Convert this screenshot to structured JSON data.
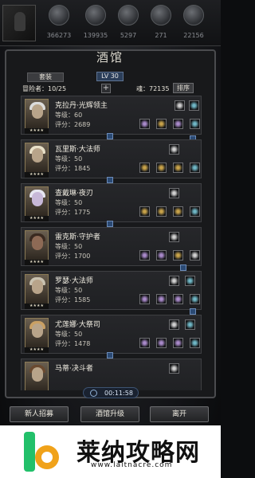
{
  "resources": [
    {
      "icon": "gold-orb-icon",
      "value": "366273"
    },
    {
      "icon": "silver-orb-icon",
      "value": "139935"
    },
    {
      "icon": "gem-orb-icon",
      "value": "5297"
    },
    {
      "icon": "soul-orb-icon",
      "value": "271"
    },
    {
      "icon": "dark-orb-icon",
      "value": "22156"
    }
  ],
  "panel": {
    "title": "酒馆",
    "tab_label": "套装",
    "level": "LV 30",
    "adventurers": "冒险者：10/25",
    "souls": "魂：72135",
    "sort_label": "排序"
  },
  "heroes": [
    {
      "name": "克拉丹·光辉领主",
      "level": "等级：60",
      "score": "评分：2689",
      "stars": "★★★★"
    },
    {
      "name": "瓦里斯·大法师",
      "level": "等级：50",
      "score": "评分：1845",
      "stars": "★★★★"
    },
    {
      "name": "查戴琳·夜刃",
      "level": "等级：50",
      "score": "评分：1775",
      "stars": "★★★★"
    },
    {
      "name": "雷克斯·守护者",
      "level": "等级：50",
      "score": "评分：1700",
      "stars": "★★★★"
    },
    {
      "name": "罗瑟·大法师",
      "level": "等级：50",
      "score": "评分：1585",
      "stars": "★★★★"
    },
    {
      "name": "尤莲娜·大祭司",
      "level": "等级：50",
      "score": "评分：1478",
      "stars": "★★★★"
    },
    {
      "name": "马蒂·决斗者",
      "level": "",
      "score": "",
      "stars": ""
    }
  ],
  "timer": "00:11:58",
  "buttons": {
    "recruit": "新人招募",
    "upgrade": "酒馆升级",
    "leave": "离开"
  },
  "watermark": {
    "text": "莱纳攻略网",
    "url": "www.laitnacre.com"
  }
}
